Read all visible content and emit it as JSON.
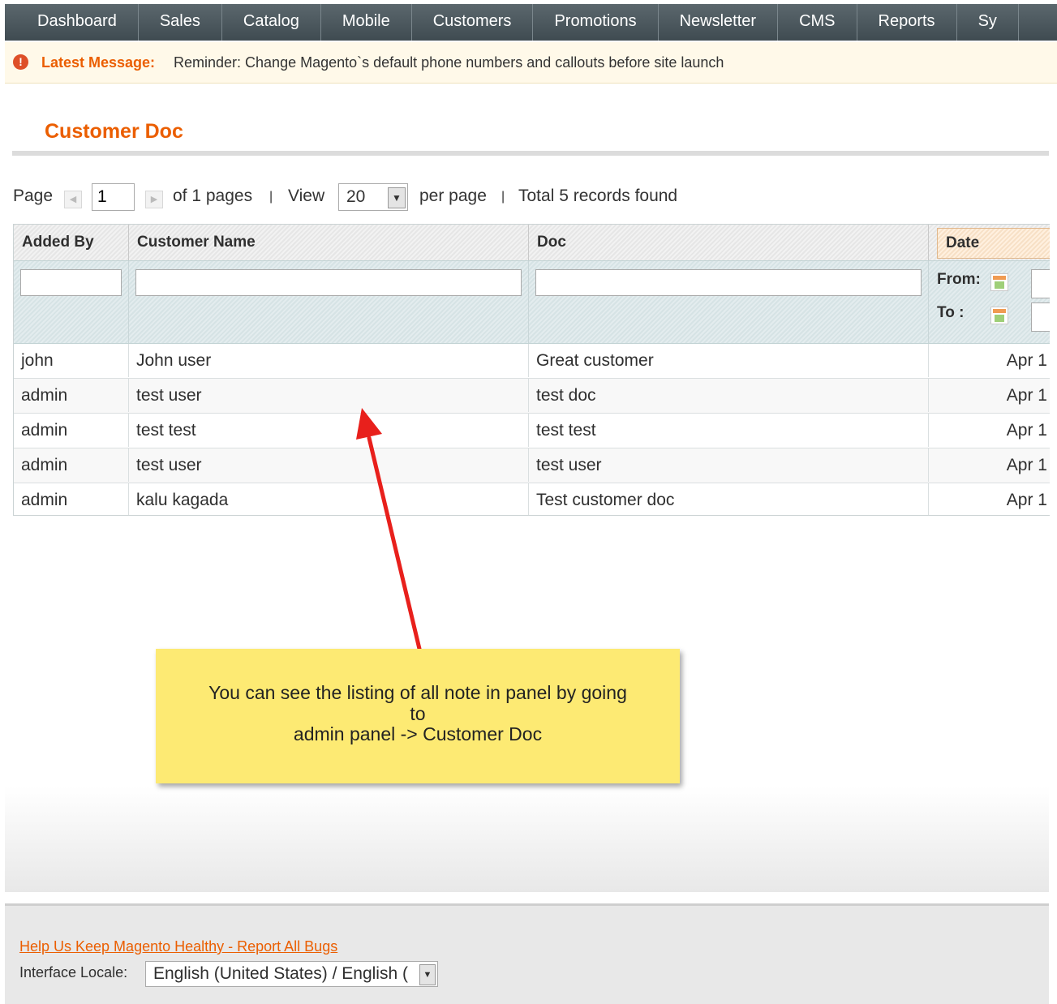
{
  "nav": {
    "items": [
      "Dashboard",
      "Sales",
      "Catalog",
      "Mobile",
      "Customers",
      "Promotions",
      "Newsletter",
      "CMS",
      "Reports",
      "Sy"
    ]
  },
  "message": {
    "label": "Latest Message:",
    "text": "Reminder: Change Magento`s default phone numbers and callouts before site launch",
    "icon": "alert-icon"
  },
  "page": {
    "title": "Customer Doc"
  },
  "pager": {
    "page_label": "Page",
    "page_value": "1",
    "of_pages": "of 1 pages",
    "sep1": "|",
    "view_label": "View",
    "view_value": "20",
    "per_page": "per page",
    "sep2": "|",
    "total": "Total 5 records found"
  },
  "grid": {
    "columns": [
      "Added By",
      "Customer Name",
      "Doc",
      "Date"
    ],
    "filter": {
      "from_label": "From:",
      "to_label": "To :"
    },
    "rows": [
      {
        "added_by": "john",
        "customer": "John user",
        "doc": "Great customer",
        "date": "Apr 1"
      },
      {
        "added_by": "admin",
        "customer": "test user",
        "doc": "test doc",
        "date": "Apr 1"
      },
      {
        "added_by": "admin",
        "customer": "test test",
        "doc": "test test",
        "date": "Apr 1"
      },
      {
        "added_by": "admin",
        "customer": "test user",
        "doc": "test user",
        "date": "Apr 1"
      },
      {
        "added_by": "admin",
        "customer": "kalu kagada",
        "doc": "Test customer doc",
        "date": "Apr 1"
      }
    ]
  },
  "callout": {
    "line1": "You can see the listing of all note in panel by going",
    "line2": "to",
    "line3": "admin panel -> Customer Doc",
    "arrow_color": "#e8201c",
    "bg_color": "#fdea73"
  },
  "footer": {
    "help_link": "Help Us Keep Magento Healthy - Report All Bugs",
    "locale_label": "Interface Locale:",
    "locale_value": "English (United States) / English ("
  },
  "colors": {
    "accent": "#eb5e00",
    "nav_bg": "#4d5a61"
  }
}
